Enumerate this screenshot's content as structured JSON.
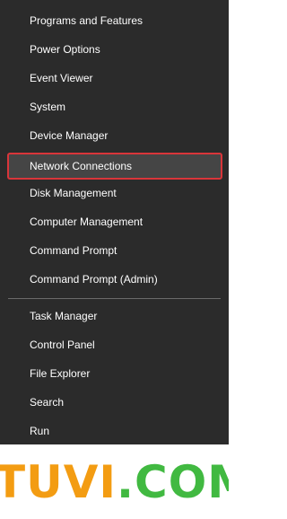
{
  "menu": {
    "items": [
      {
        "label": "Programs and Features"
      },
      {
        "label": "Power Options"
      },
      {
        "label": "Event Viewer"
      },
      {
        "label": "System"
      },
      {
        "label": "Device Manager"
      },
      {
        "label": "Network Connections",
        "highlighted": true
      },
      {
        "label": "Disk Management"
      },
      {
        "label": "Computer Management"
      },
      {
        "label": "Command Prompt"
      },
      {
        "label": "Command Prompt (Admin)"
      },
      {
        "label": "Task Manager"
      },
      {
        "label": "Control Panel"
      },
      {
        "label": "File Explorer"
      },
      {
        "label": "Search"
      },
      {
        "label": "Run"
      }
    ]
  },
  "watermark": {
    "part1": "TUVI",
    "part2": ".COM"
  },
  "colors": {
    "menu_background": "#2b2b2b",
    "highlight_border": "#d9353a",
    "highlight_fill": "#454545",
    "watermark_orange": "#f39c12",
    "watermark_green": "#41b941"
  }
}
